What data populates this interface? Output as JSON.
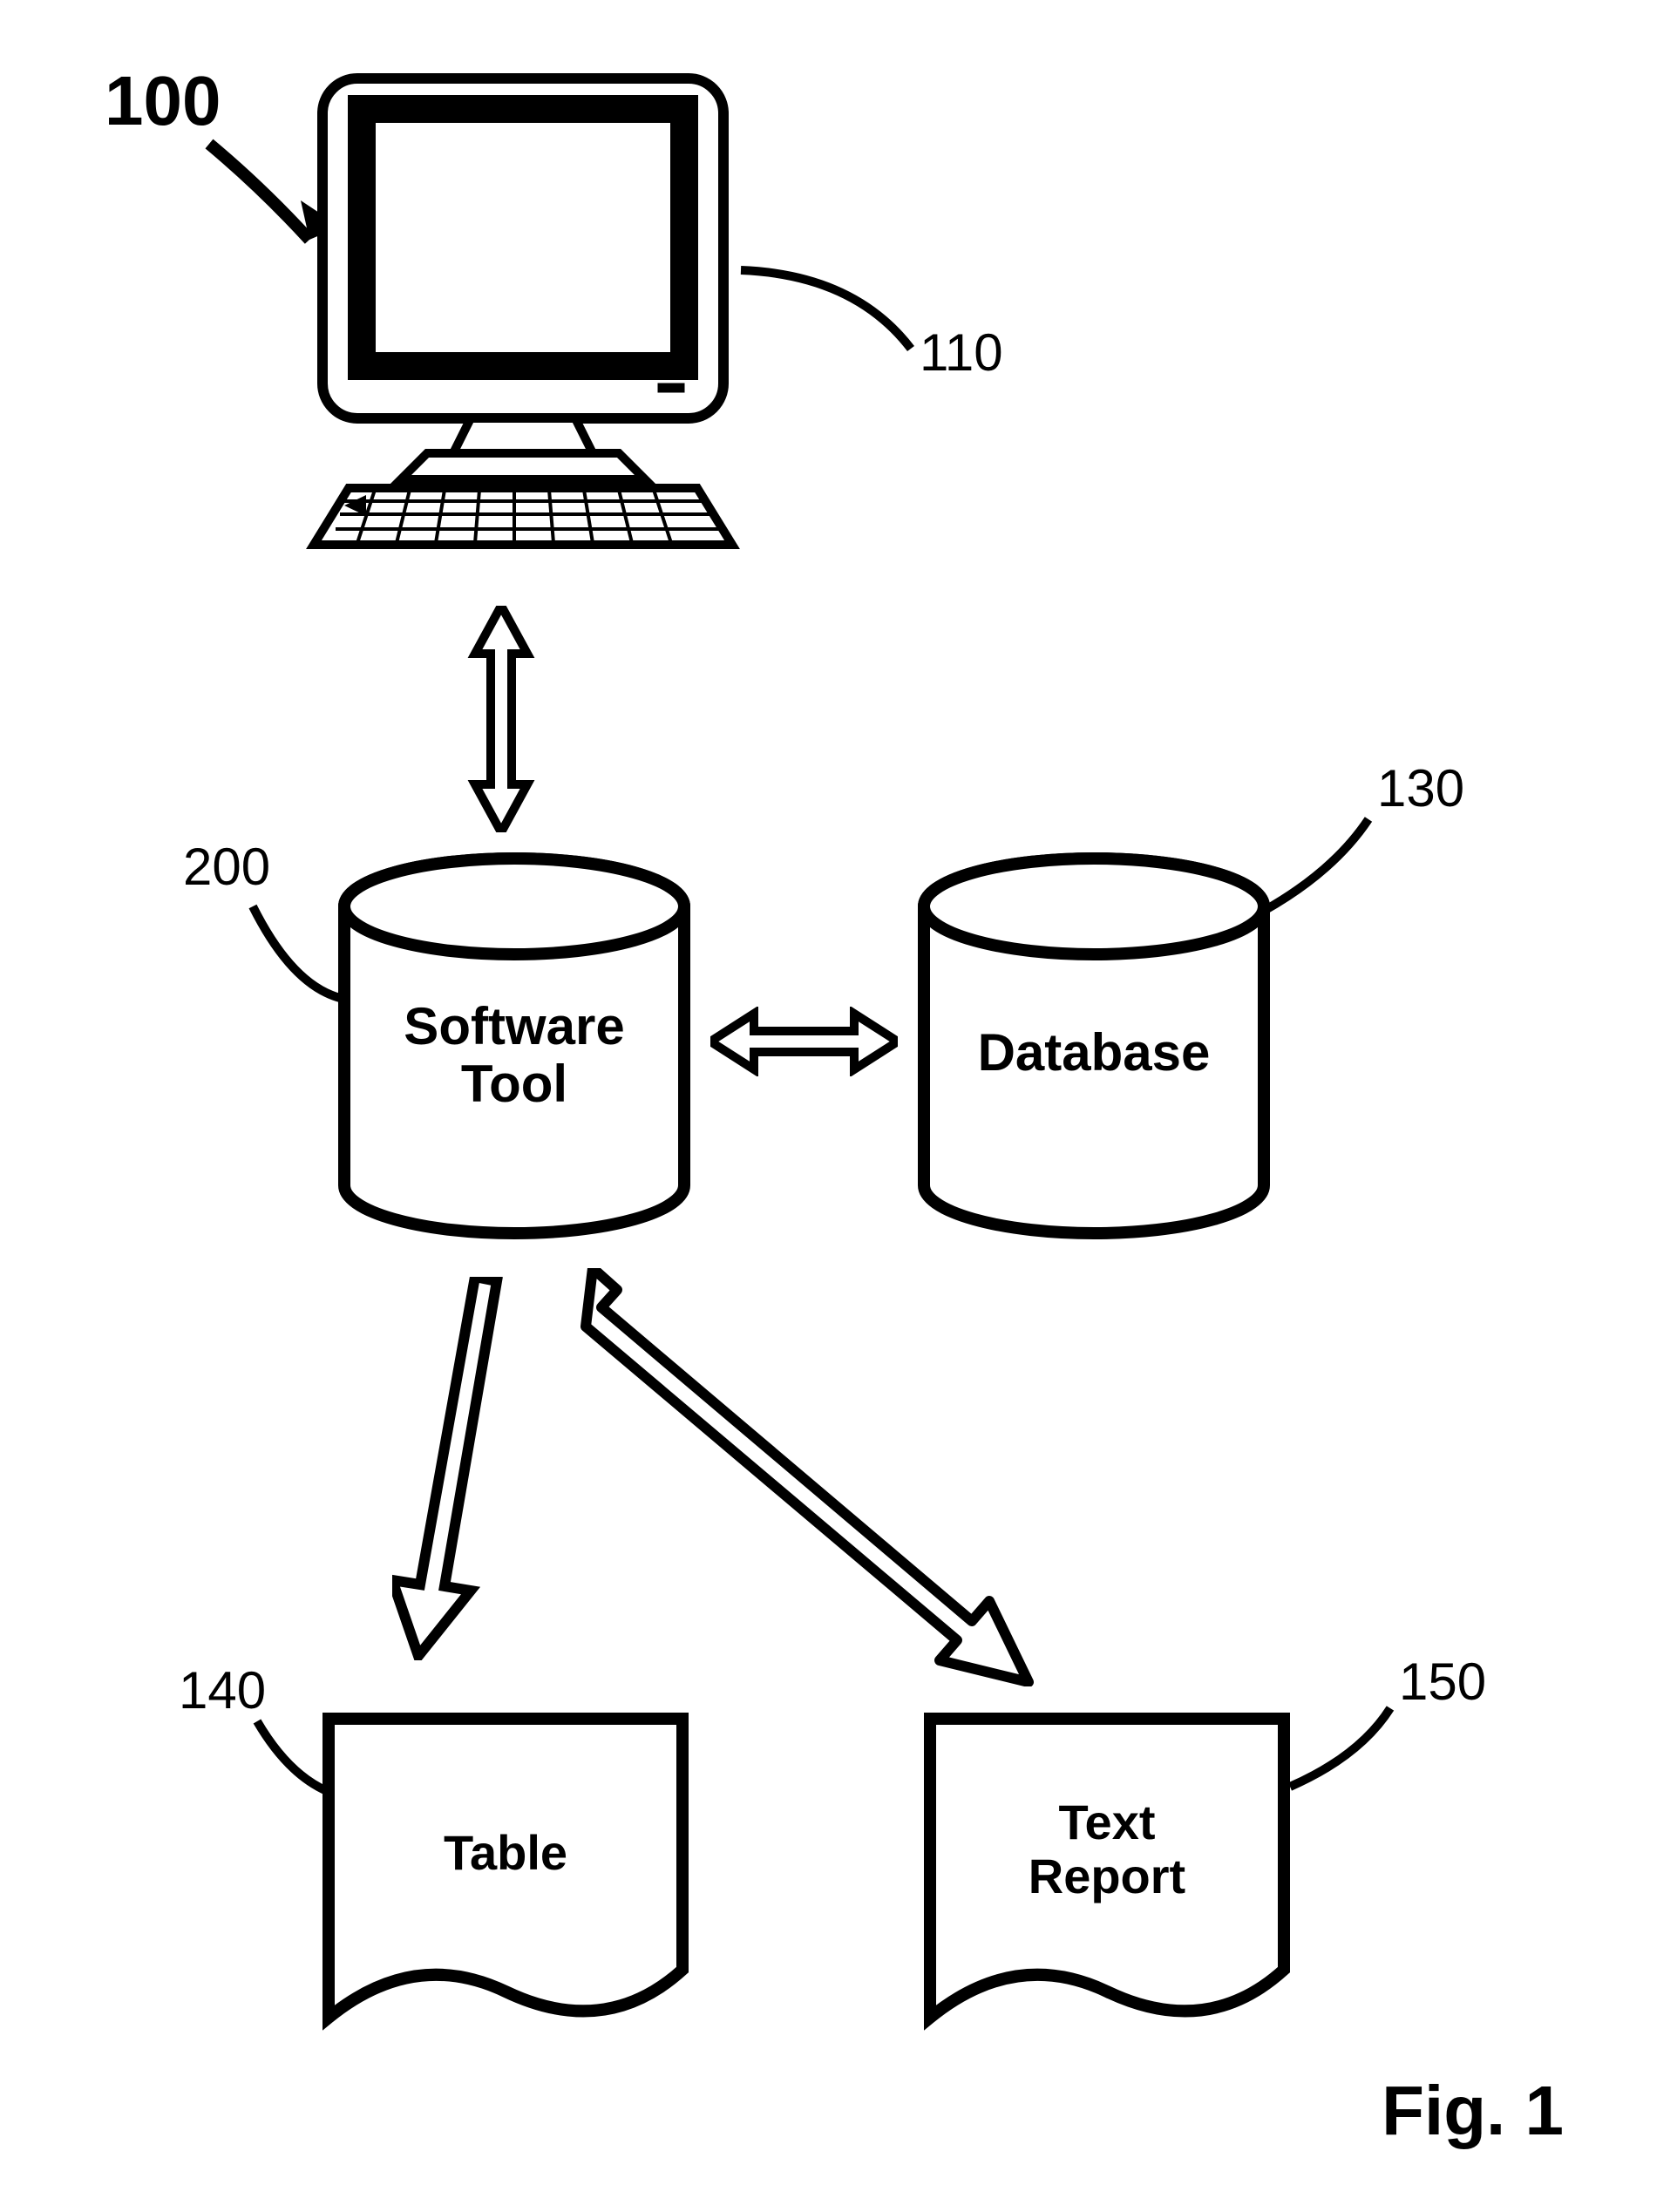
{
  "figure": {
    "title_ref": "100",
    "caption": "Fig. 1",
    "nodes": {
      "computer": {
        "ref": "110"
      },
      "software_tool": {
        "ref": "200",
        "label_line1": "Software",
        "label_line2": "Tool"
      },
      "database": {
        "ref": "130",
        "label": "Database"
      },
      "table": {
        "ref": "140",
        "label": "Table"
      },
      "text_report": {
        "ref": "150",
        "label_line1": "Text",
        "label_line2": "Report"
      }
    }
  }
}
